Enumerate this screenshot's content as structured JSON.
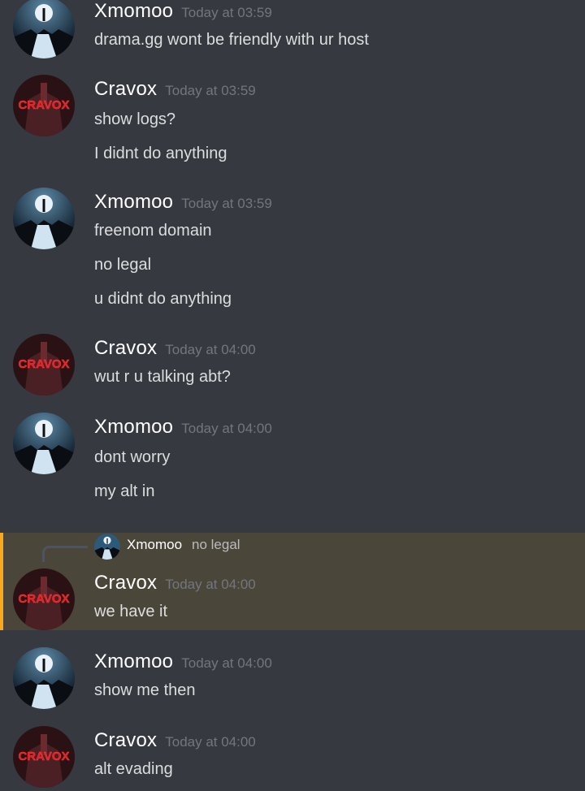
{
  "messages": [
    {
      "user": "Xmomoo",
      "time": "Today at 03:59",
      "lines": [
        "drama.gg wont be friendly with ur host"
      ]
    },
    {
      "user": "Cravox",
      "time": "Today at 03:59",
      "lines": [
        "show logs?",
        "I didnt do anything"
      ]
    },
    {
      "user": "Xmomoo",
      "time": "Today at 03:59",
      "lines": [
        "freenom domain",
        "no legal",
        "u didnt do anything"
      ]
    },
    {
      "user": "Cravox",
      "time": "Today at 04:00",
      "lines": [
        "wut r u talking abt?"
      ]
    },
    {
      "user": "Xmomoo",
      "time": "Today at 04:00",
      "lines": [
        "dont worry",
        "my alt in"
      ]
    },
    {
      "user": "Cravox",
      "time": "Today at 04:00",
      "lines": [
        "we have it"
      ],
      "reply": {
        "user": "Xmomoo",
        "text": "no legal"
      }
    },
    {
      "user": "Xmomoo",
      "time": "Today at 04:00",
      "lines": [
        "show me then"
      ]
    },
    {
      "user": "Cravox",
      "time": "Today at 04:00",
      "lines": [
        "alt evading"
      ]
    }
  ],
  "avatars": {
    "Xmomoo": {
      "icon": "night-sky-figure-avatar",
      "sky": "#2e5a7a",
      "ground": "#0d0f14"
    },
    "Cravox": {
      "icon": "red-text-dark-avatar",
      "bg": "#2a1214",
      "logo_text": "CRAVOX",
      "logo_color": "#e21f26"
    }
  },
  "colors": {
    "background": "#36393f",
    "highlight": "#4a4639",
    "highlight_bar": "#faa81a",
    "timestamp": "#72767d"
  }
}
